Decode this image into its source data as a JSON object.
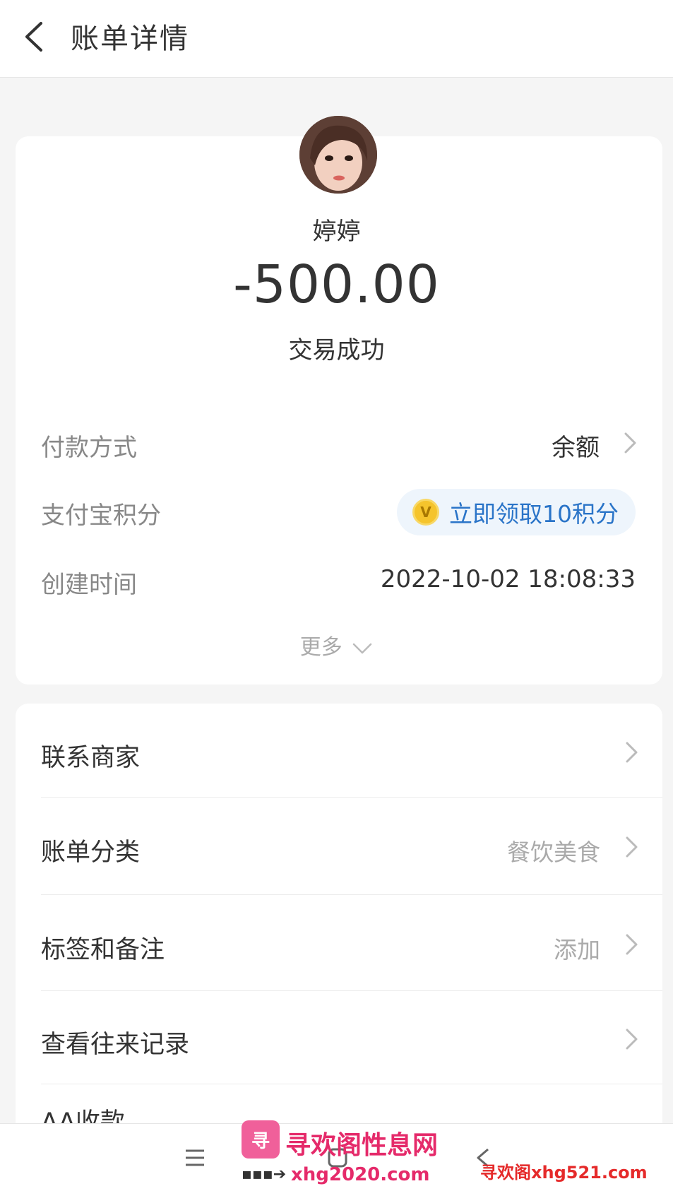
{
  "header": {
    "title": "账单详情"
  },
  "transaction": {
    "name": "婷婷",
    "amount": "-500.00",
    "status": "交易成功"
  },
  "details": {
    "payment_method_label": "付款方式",
    "payment_method_value": "余额",
    "points_label": "支付宝积分",
    "points_coin": "V",
    "points_action": "立即领取10积分",
    "created_label": "创建时间",
    "created_value": "2022-10-02 18:08:33",
    "more_label": "更多"
  },
  "actions": {
    "contact_merchant": "联系商家",
    "bill_category_label": "账单分类",
    "bill_category_value": "餐饮美食",
    "tags_notes_label": "标签和备注",
    "tags_notes_value": "添加",
    "view_history": "查看往来记录",
    "aa_collect": "AA收款"
  },
  "watermark": {
    "logo_text": "寻",
    "site_name_cn": "寻欢阁性息网",
    "domain": "xhg2020.com",
    "right_text": "寻欢阁xhg521.com"
  },
  "colors": {
    "accent_blue": "#2a74c8",
    "coin_gold": "#f5c42c",
    "watermark_pink": "#e52a6a"
  }
}
